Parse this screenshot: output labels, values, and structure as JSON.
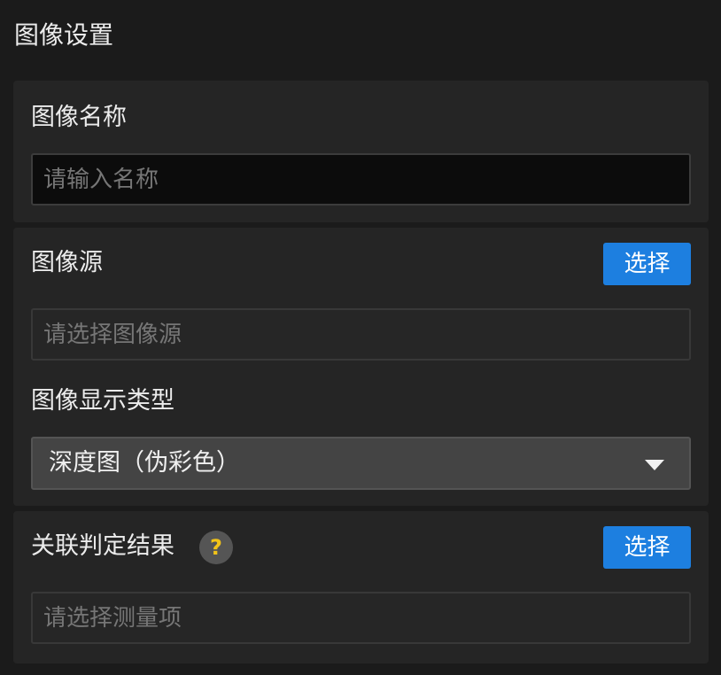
{
  "panel": {
    "title": "图像设置"
  },
  "image_name": {
    "label": "图像名称",
    "placeholder": "请输入名称",
    "value": ""
  },
  "image_source": {
    "label": "图像源",
    "select_button": "选择",
    "placeholder": "请选择图像源",
    "value": ""
  },
  "display_type": {
    "label": "图像显示类型",
    "selected": "深度图（伪彩色）"
  },
  "judgement": {
    "label": "关联判定结果",
    "help_glyph": "?",
    "select_button": "选择",
    "placeholder": "请选择测量项",
    "value": ""
  },
  "icons": {
    "help": "question-circle-icon",
    "dropdown": "triangle-down-icon"
  },
  "colors": {
    "accent": "#1d7fe0",
    "help_mark": "#f2c318",
    "background": "#1b1b1b",
    "section": "#252525"
  }
}
